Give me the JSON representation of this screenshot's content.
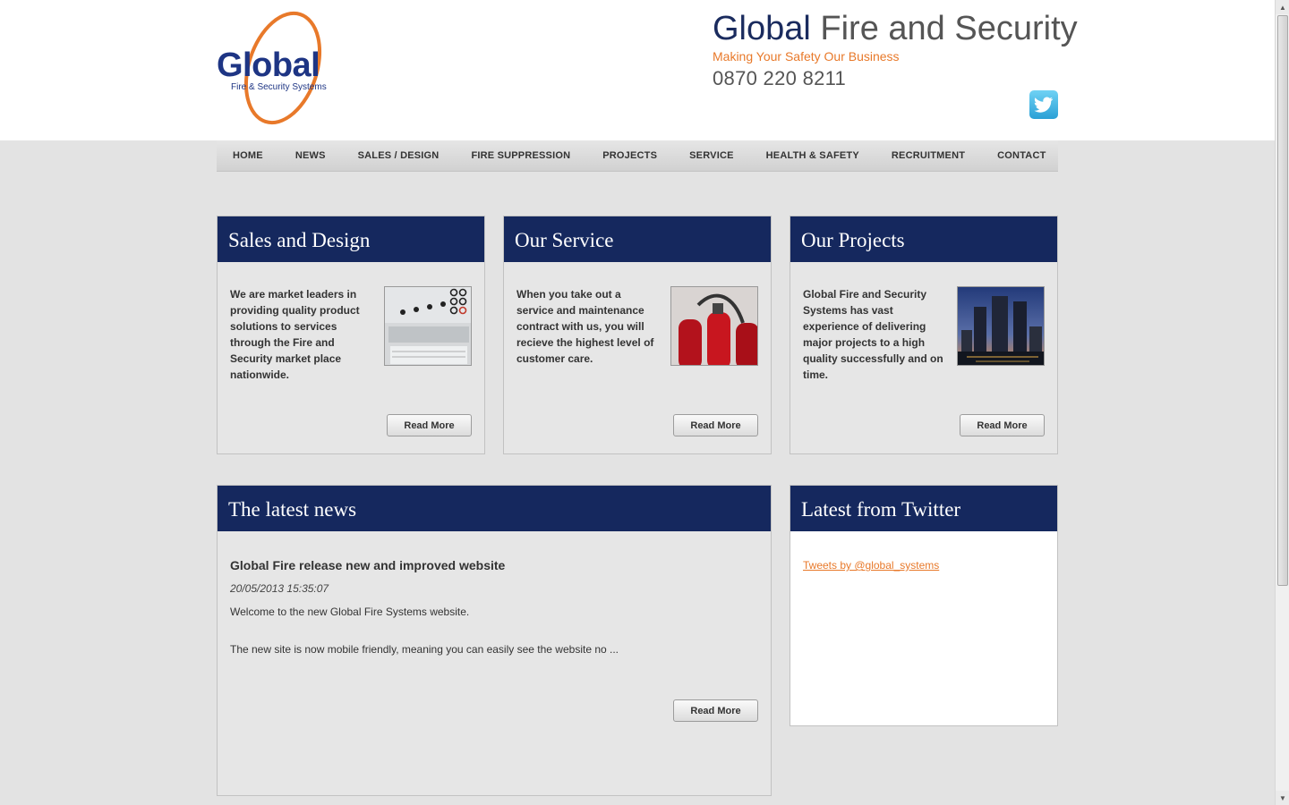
{
  "header": {
    "logo": {
      "word": "Global",
      "sub": "Fire & Security Systems"
    },
    "title_primary": "Global",
    "title_secondary": "Fire and Security",
    "tagline": "Making Your Safety Our Business",
    "phone": "0870 220 8211",
    "twitter_icon": "twitter-bird-icon"
  },
  "nav": {
    "items": [
      {
        "label": "HOME"
      },
      {
        "label": "NEWS"
      },
      {
        "label": "SALES / DESIGN"
      },
      {
        "label": "FIRE SUPPRESSION"
      },
      {
        "label": "PROJECTS"
      },
      {
        "label": "SERVICE"
      },
      {
        "label": "HEALTH & SAFETY"
      },
      {
        "label": "RECRUITMENT"
      },
      {
        "label": "CONTACT"
      }
    ]
  },
  "panels": [
    {
      "title": "Sales and Design",
      "text": "We are market leaders in providing quality product solutions to services through the Fire and Security market place nationwide.",
      "button": "Read More"
    },
    {
      "title": "Our Service",
      "text": "When you take out a service and maintenance contract with us, you will recieve the highest level of customer care.",
      "button": "Read More"
    },
    {
      "title": "Our Projects",
      "text": "Global Fire and Security Systems has vast experience of delivering major projects to a high quality successfully and on time.",
      "button": "Read More"
    }
  ],
  "news": {
    "heading": "The latest news",
    "title": "Global Fire release new and improved website",
    "date": "20/05/2013 15:35:07",
    "p1": "Welcome to the new Global Fire Systems website.",
    "p2": "The new site is now mobile friendly, meaning you can easily see the website no ...",
    "button": "Read More"
  },
  "twitter": {
    "heading": "Latest from Twitter",
    "link": "Tweets by @global_systems"
  },
  "colors": {
    "navy": "#15285e",
    "orange": "#e8792a",
    "background": "#e3e3e3"
  }
}
